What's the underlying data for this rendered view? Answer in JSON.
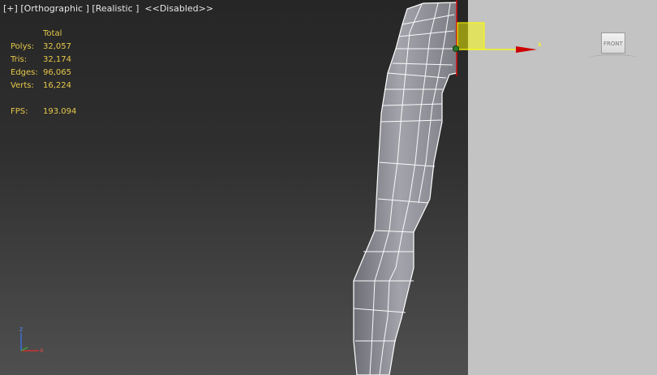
{
  "viewport": {
    "label": {
      "plus": "[+]",
      "view": "[Orthographic ]",
      "shading": "[Realistic ]",
      "extra": "<<Disabled>>"
    },
    "stats": {
      "header": "Total",
      "rows": [
        {
          "label": "Polys:",
          "value": "32,057"
        },
        {
          "label": "Tris:",
          "value": "32,174"
        },
        {
          "label": "Edges:",
          "value": "96,065"
        },
        {
          "label": "Verts:",
          "value": "16,224"
        }
      ],
      "fps_label": "FPS:",
      "fps_value": "193.094"
    },
    "axis_tripod": {
      "z": "z",
      "x": "x"
    }
  },
  "gizmo": {
    "x_label": "x",
    "x_color": "#ffff00",
    "arrow_color": "#cc0000",
    "plane_color": "#ffff00"
  },
  "viewcube": {
    "face_label": "FRONT"
  },
  "colors": {
    "stats_text": "#e6c84a",
    "label_text": "#e6e6e6",
    "side_panel_bg": "#c3c3c3",
    "mesh_fill": "#8e8f96",
    "mesh_wire": "#ffffff"
  }
}
